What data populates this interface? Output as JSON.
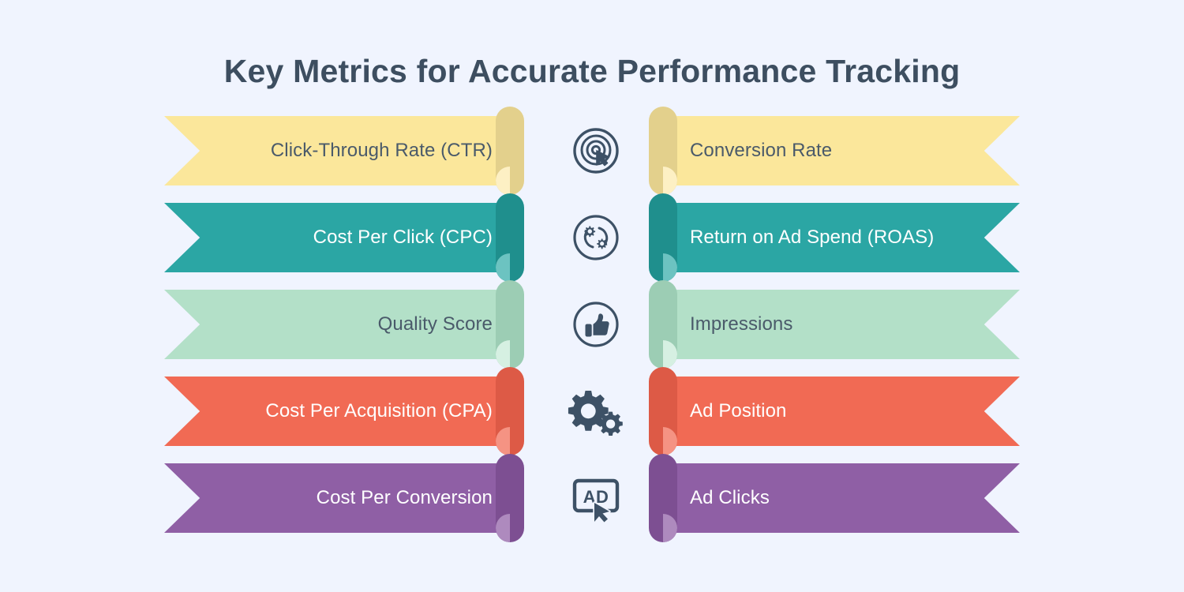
{
  "page": {
    "title": "Key Metrics for Accurate Performance Tracking",
    "background_color": "#f0f4fe",
    "title_color": "#3d4e60",
    "icon_color": "#3d5166"
  },
  "rows": [
    {
      "color": "#fbe79b",
      "fold_color": "#e3d08c",
      "fold_dot_color": "#fdf0c4",
      "text_color": "#4a5a6a",
      "icon": "click-target-icon",
      "left_label": "Click-Through Rate (CTR)",
      "right_label": "Conversion Rate"
    },
    {
      "color": "#2ba6a4",
      "fold_color": "#1f8f8d",
      "fold_dot_color": "#6cc3c1",
      "text_color": "#ffffff",
      "icon": "gears-cycle-icon",
      "left_label": "Cost Per Click (CPC)",
      "right_label": "Return on Ad Spend (ROAS)"
    },
    {
      "color": "#b3e0c8",
      "fold_color": "#9ccdb4",
      "fold_dot_color": "#d6f0e2",
      "text_color": "#4a5a6a",
      "icon": "thumbs-up-icon",
      "left_label": "Quality Score",
      "right_label": "Impressions"
    },
    {
      "color": "#f16a54",
      "fold_color": "#dd5a46",
      "fold_dot_color": "#f59383",
      "text_color": "#ffffff",
      "icon": "gears-icon",
      "left_label": "Cost Per Acquisition (CPA)",
      "right_label": "Ad Position"
    },
    {
      "color": "#8f5fa5",
      "fold_color": "#7d4f92",
      "fold_dot_color": "#ae8abe",
      "text_color": "#ffffff",
      "icon": "ad-click-icon",
      "left_label": "Cost Per Conversion",
      "right_label": "Ad Clicks"
    }
  ]
}
